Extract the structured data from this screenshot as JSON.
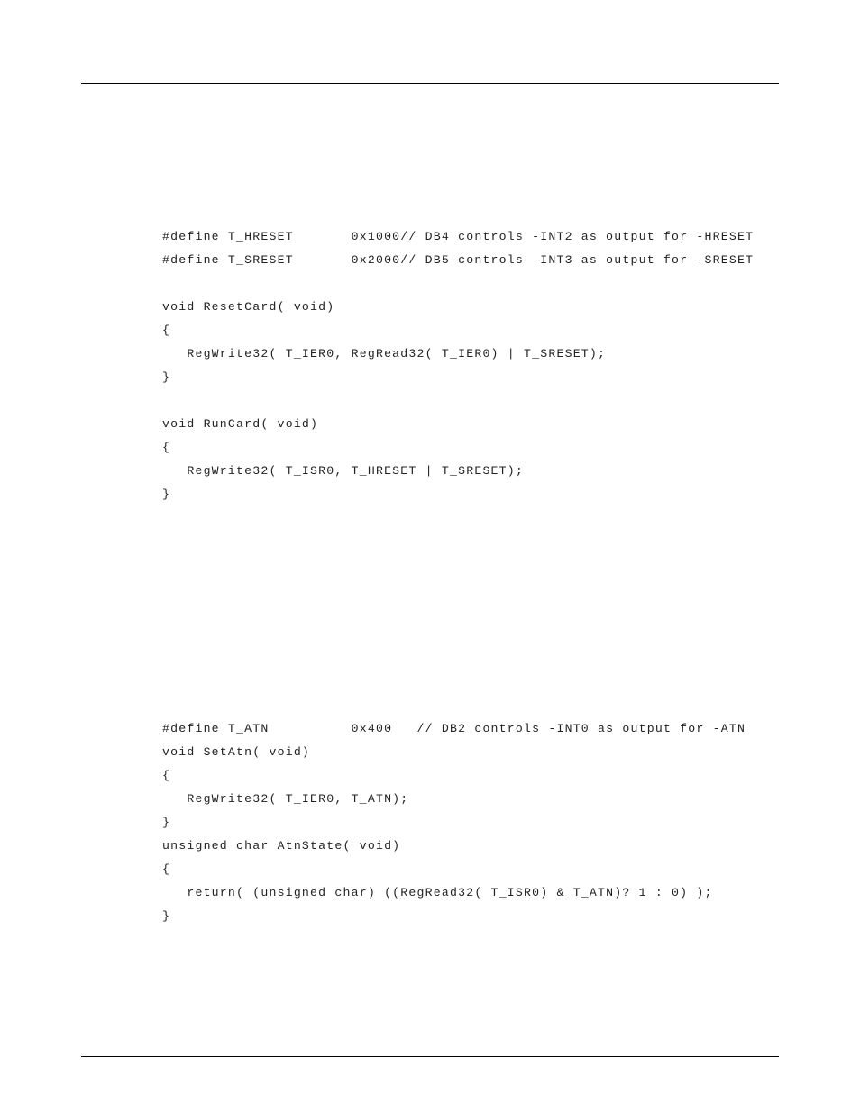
{
  "code": {
    "l1": "#define T_HRESET       0x1000// DB4 controls -INT2 as output for -HRESET",
    "l2": "#define T_SRESET       0x2000// DB5 controls -INT3 as output for -SRESET",
    "l3": "",
    "l4": "void ResetCard( void)",
    "l5": "{",
    "l6": "   RegWrite32( T_IER0, RegRead32( T_IER0) | T_SRESET);",
    "l7": "}",
    "l8": "",
    "l9": "void RunCard( void)",
    "l10": "{",
    "l11": "   RegWrite32( T_ISR0, T_HRESET | T_SRESET);",
    "l12": "}",
    "l13": "#define T_ATN          0x400   // DB2 controls -INT0 as output for -ATN",
    "l14": "void SetAtn( void)",
    "l15": "{",
    "l16": "   RegWrite32( T_IER0, T_ATN);",
    "l17": "}",
    "l18": "unsigned char AtnState( void)",
    "l19": "{",
    "l20": "   return( (unsigned char) ((RegRead32( T_ISR0) & T_ATN)? 1 : 0) );",
    "l21": "}"
  }
}
